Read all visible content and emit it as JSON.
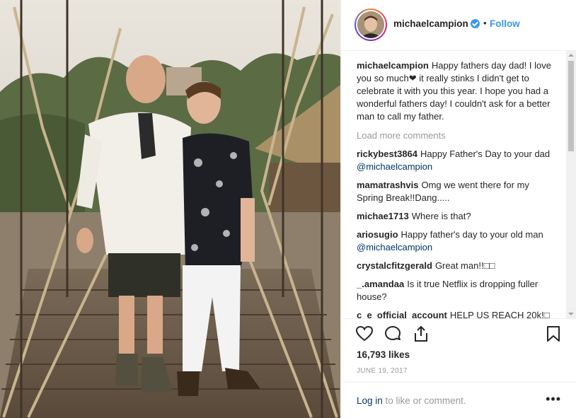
{
  "post": {
    "username": "michaelcampion",
    "follow_label": "Follow",
    "dot": "•",
    "caption": {
      "username": "michaelcampion",
      "text": "Happy fathers day dad! I love you so much❤ it really stinks I didn't get to celebrate it with you this year. I hope you had a wonderful fathers day! I couldn't ask for a better man to call my father."
    },
    "load_more": "Load more comments",
    "comments": [
      {
        "username": "rickybest3864",
        "text": "Happy Father's Day to your dad ",
        "mention": "@michaelcampion"
      },
      {
        "username": "mamatrashvis",
        "text": "Omg we went there for my Spring Break!!Dang.....",
        "mention": ""
      },
      {
        "username": "michae1713",
        "text": "Where is that?",
        "mention": ""
      },
      {
        "username": "ariosugio",
        "text": "Happy father's day to your old man ",
        "mention": "@michaelcampion"
      },
      {
        "username": "crystalcfitzgerald",
        "text": "Great man!!□□",
        "mention": ""
      },
      {
        "username": "_.amandaa",
        "text": "Is it true Netflix is dropping fuller house?",
        "mention": ""
      },
      {
        "username": "c_e_official_account",
        "text": "HELP US REACH 20k!□",
        "mention": ""
      }
    ],
    "likes": "16,793 likes",
    "date": "JUNE 19, 2017",
    "login_link": "Log in",
    "login_rest": " to like or comment.",
    "more": "•••"
  },
  "colors": {
    "link_blue": "#3897f0",
    "mention_blue": "#003569",
    "muted": "#999999",
    "text": "#262626"
  },
  "icons": {
    "like": "heart-icon",
    "comment": "comment-icon",
    "share": "share-icon",
    "save": "bookmark-icon",
    "verified": "verified-badge-icon"
  }
}
